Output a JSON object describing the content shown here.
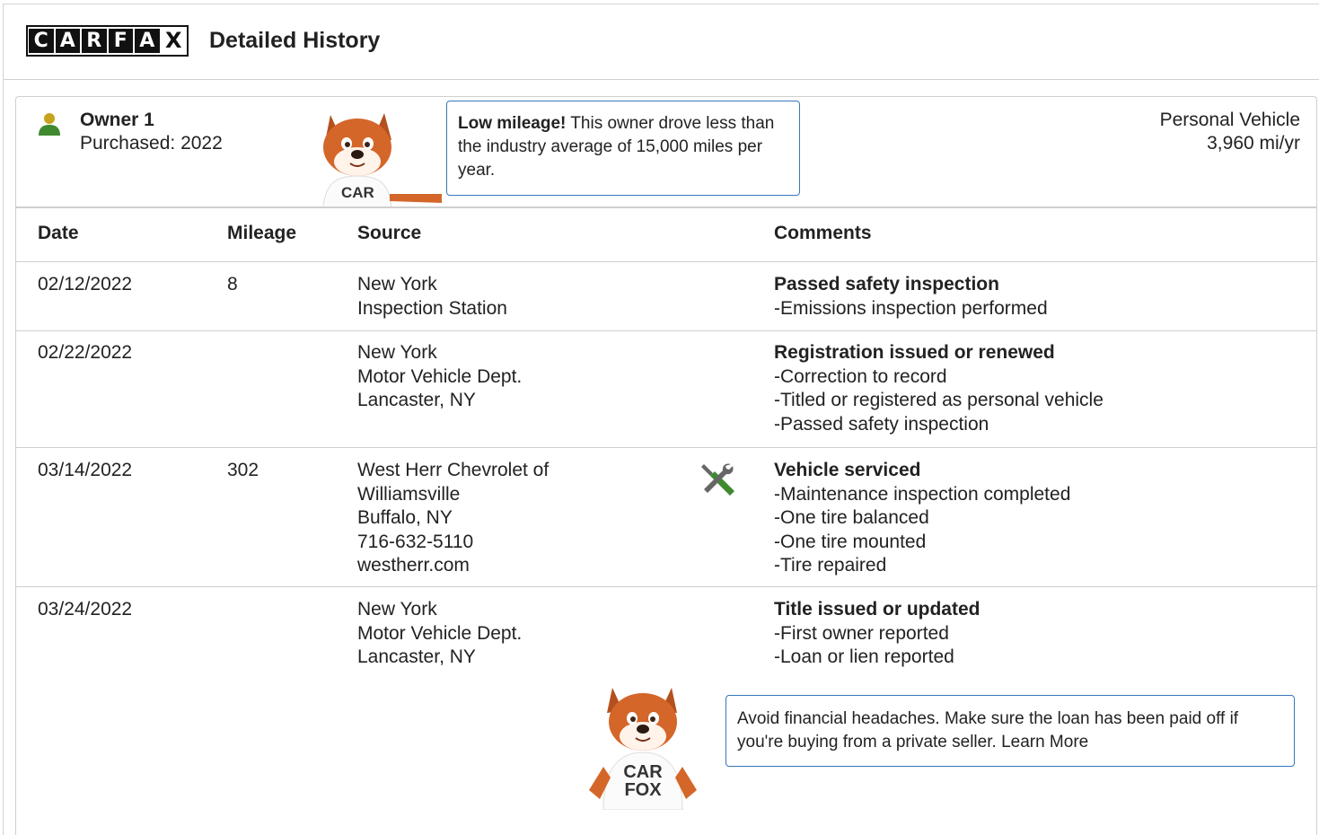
{
  "header": {
    "logo_letters": [
      "C",
      "A",
      "R",
      "F",
      "A",
      "X"
    ],
    "title": "Detailed History"
  },
  "owner": {
    "name": "Owner 1",
    "purchased": "Purchased: 2022",
    "vehicle_type": "Personal Vehicle",
    "miles_per_year": "3,960 mi/yr",
    "icon": "person-icon",
    "icon_colors": {
      "head": "#c8a21a",
      "body": "#3f8a2e"
    }
  },
  "low_mileage_callout": {
    "bold": "Low mileage!",
    "text": " This owner drove less than the industry average of 15,000 miles per year."
  },
  "table": {
    "headers": {
      "date": "Date",
      "mileage": "Mileage",
      "source": "Source",
      "comments": "Comments"
    },
    "rows": [
      {
        "date": "02/12/2022",
        "mileage": "8",
        "source": [
          "New York",
          "Inspection Station"
        ],
        "comment_title": "Passed safety inspection",
        "comment_lines": [
          "Emissions inspection performed"
        ]
      },
      {
        "date": "02/22/2022",
        "mileage": "",
        "source": [
          "New York",
          "Motor Vehicle Dept.",
          "Lancaster, NY"
        ],
        "comment_title": "Registration issued or renewed",
        "comment_lines": [
          "Correction to record",
          "Titled or registered as personal vehicle",
          "Passed safety inspection"
        ]
      },
      {
        "date": "03/14/2022",
        "mileage": "302",
        "source": [
          "West Herr Chevrolet of",
          "Williamsville",
          "Buffalo, NY",
          "716-632-5110",
          "westherr.com"
        ],
        "comment_title": "Vehicle serviced",
        "comment_lines": [
          "Maintenance inspection completed",
          "One tire balanced",
          "One tire mounted",
          "Tire repaired"
        ],
        "icon": "service-tools-icon"
      },
      {
        "date": "03/24/2022",
        "mileage": "",
        "source": [
          "New York",
          "Motor Vehicle Dept.",
          "Lancaster, NY"
        ],
        "comment_title": "Title issued or updated",
        "comment_lines": [
          "First owner reported",
          "Loan or lien reported"
        ]
      }
    ]
  },
  "loan_callout": {
    "text": "Avoid financial headaches. Make sure the loan has been paid off if you're buying from a private seller.",
    "link": "Learn More"
  },
  "mascot": {
    "shirt_text_1": "CAR",
    "shirt_text_2": "FOX"
  },
  "colors": {
    "callout_border": "#3777bc",
    "divider": "#cfcfcf",
    "tool_green": "#3f8a2e",
    "tool_gray": "#666666"
  }
}
